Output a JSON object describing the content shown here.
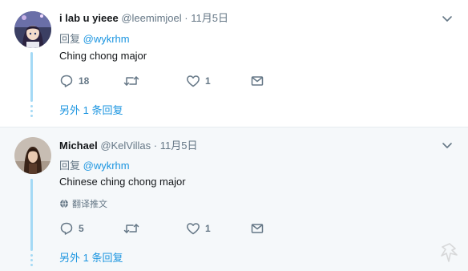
{
  "tweets": [
    {
      "name": "i lab u yieee",
      "handle": "@leemimjoel",
      "separator": "·",
      "time": "11月5日",
      "reply_prefix": "回复",
      "reply_mention": "@wykrhm",
      "text": "Ching chong major",
      "reply_count": "18",
      "retweet_count": "",
      "like_count": "1",
      "more_replies": "另外 1 条回复",
      "avatar_icon": "anime-avatar"
    },
    {
      "name": "Michael",
      "handle": "@KelVillas",
      "separator": "·",
      "time": "11月5日",
      "reply_prefix": "回复",
      "reply_mention": "@wykrhm",
      "text": "Chinese ching chong major",
      "translate_label": "翻译推文",
      "reply_count": "5",
      "retweet_count": "",
      "like_count": "1",
      "more_replies": "另外 1 条回复",
      "avatar_icon": "photo-avatar"
    }
  ],
  "colors": {
    "link": "#1b95e0",
    "muted": "#657786",
    "thread_line": "#a4d9f5"
  }
}
